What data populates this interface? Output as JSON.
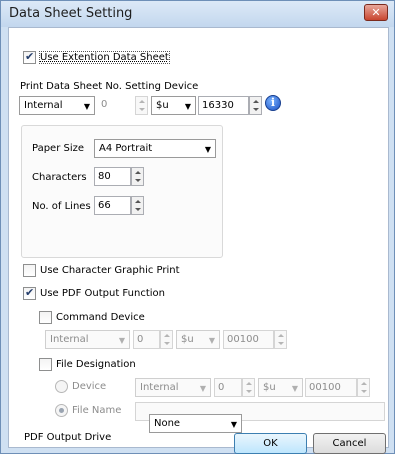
{
  "window": {
    "title": "Data Sheet Setting",
    "close_label": "✕"
  },
  "use_extension": {
    "label": "Use Extention Data Sheet",
    "checked": true
  },
  "print_device": {
    "label": "Print Data Sheet No. Setting Device",
    "type": "Internal",
    "station": "0",
    "device_type": "$u",
    "address": "16330",
    "info_icon_glyph": "i"
  },
  "paper": {
    "paper_size_label": "Paper Size",
    "paper_size": "A4 Portrait",
    "characters_label": "Characters",
    "characters": "80",
    "lines_label": "No. of Lines",
    "lines": "66"
  },
  "char_graphic": {
    "label": "Use Character Graphic Print",
    "checked": false
  },
  "pdf_output": {
    "label": "Use PDF Output Function",
    "checked": true
  },
  "command_device": {
    "label": "Command Device",
    "checked": false,
    "type": "Internal",
    "station": "0",
    "device_type": "$u",
    "address": "00100"
  },
  "file_designation": {
    "label": "File Designation",
    "checked": false,
    "device_label": "Device",
    "device_selected": false,
    "type": "Internal",
    "station": "0",
    "device_type": "$u",
    "address": "00100",
    "file_name_label": "File Name",
    "file_name_selected": true,
    "file_name": ""
  },
  "pdf_drive": {
    "label": "PDF Output Drive",
    "value": "None"
  },
  "buttons": {
    "ok": "OK",
    "cancel": "Cancel"
  },
  "icons": {
    "dropdown_arrow": "▼"
  }
}
